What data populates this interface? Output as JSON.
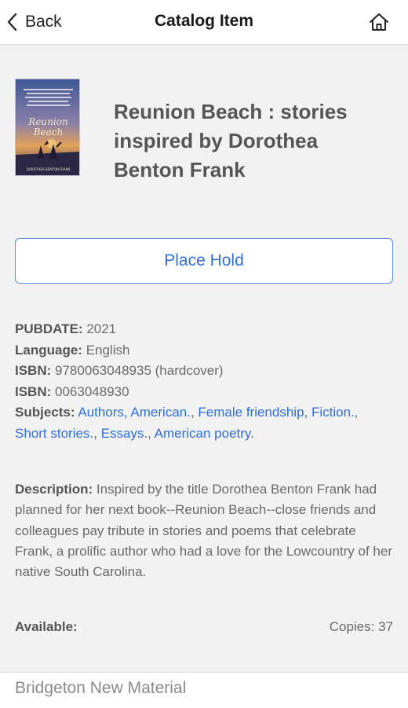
{
  "nav": {
    "back_label": "Back",
    "title": "Catalog Item",
    "home_icon": "home-icon"
  },
  "item": {
    "title": "Reunion Beach : stories inspired by Dorothea Benton Frank",
    "cover": {
      "title_line1": "Reunion",
      "title_line2": "Beach",
      "byline": "DOROTHEA BENTON FRANK",
      "colors": [
        "#4a5f9a",
        "#b07a8a",
        "#e3a35a",
        "#2c2a4a"
      ]
    },
    "action_label": "Place Hold",
    "details": {
      "pubdate_label": "PUBDATE:",
      "pubdate": "2021",
      "language_label": "Language:",
      "language": "English",
      "isbn_label": "ISBN:",
      "isbn1": "9780063048935 (hardcover)",
      "isbn2": "0063048930",
      "subjects_label": "Subjects:",
      "subjects": [
        "Authors, American.",
        "Female friendship, Fiction.",
        "Short stories.",
        "Essays.",
        "American poetry."
      ]
    },
    "description_label": "Description:",
    "description": "Inspired by the title Dorothea Benton Frank had planned for her next book--Reunion Beach--close friends and colleagues pay tribute in stories and poems that celebrate Frank, a prolific author who had a love for the Lowcountry of her native South Carolina.",
    "available_label": "Available:",
    "copies_text": "Copies: 37"
  },
  "footer": {
    "location": "Bridgeton New Material"
  },
  "colors": {
    "accent": "#2f6fe0",
    "background": "#f2f2f2"
  }
}
